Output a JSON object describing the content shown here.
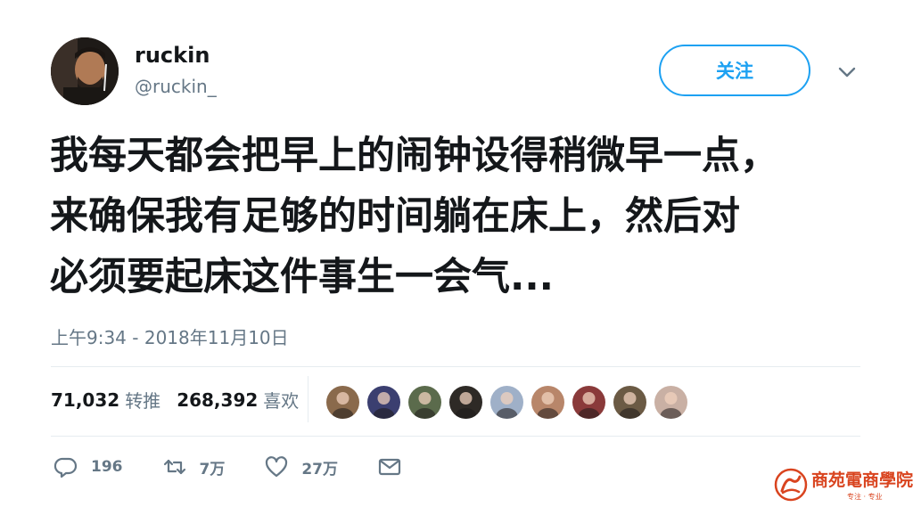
{
  "user": {
    "display_name": "ruckin",
    "handle": "@ruckin_"
  },
  "follow_button": {
    "label": "关注"
  },
  "tweet": {
    "lines": [
      "我每天都会把早上的闹钟设得稍微早一点，",
      "来确保我有足够的时间躺在床上，然后对",
      "必须要起床这件事生一会气..."
    ],
    "timestamp": "上午9:34 - 2018年11月10日"
  },
  "stats": {
    "retweets_count": "71,032",
    "retweets_label": "转推",
    "likes_count": "268,392",
    "likes_label": "喜欢"
  },
  "likers": [
    {
      "icon": "liker-avatar",
      "color": "#8a6a4c"
    },
    {
      "icon": "liker-avatar",
      "color": "#3b3f70"
    },
    {
      "icon": "liker-avatar",
      "color": "#5b6b4c"
    },
    {
      "icon": "liker-avatar",
      "color": "#2e2a26"
    },
    {
      "icon": "liker-avatar",
      "color": "#9fb0c8"
    },
    {
      "icon": "liker-avatar",
      "color": "#b8866a"
    },
    {
      "icon": "liker-avatar",
      "color": "#8a3a3a"
    },
    {
      "icon": "liker-avatar",
      "color": "#6b5a44"
    },
    {
      "icon": "liker-avatar",
      "color": "#c9b0a4"
    }
  ],
  "actions": {
    "reply_count": "196",
    "retweet_count": "7万",
    "like_count": "27万"
  },
  "watermark": {
    "text": "商苑電商學院",
    "sub": "专注 · 专业"
  },
  "colors": {
    "accent": "#1da1f2",
    "secondary_text": "#657786",
    "watermark": "#d9441f"
  }
}
